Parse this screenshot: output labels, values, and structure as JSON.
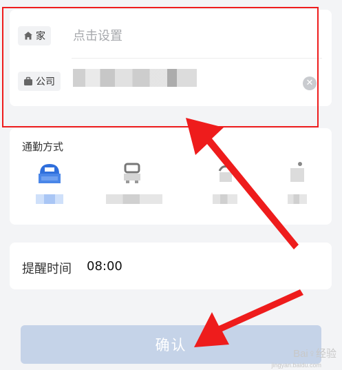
{
  "address": {
    "home_label": "家",
    "home_placeholder": "点击设置",
    "office_label": "公司",
    "clear_icon": "clear-icon"
  },
  "commute": {
    "title": "通勤方式",
    "modes": [
      {
        "name": "car",
        "selected": true
      },
      {
        "name": "bus",
        "selected": false
      },
      {
        "name": "bike",
        "selected": false
      },
      {
        "name": "walk",
        "selected": false
      }
    ]
  },
  "reminder": {
    "label": "提醒时间",
    "time": "08:00"
  },
  "confirm_label": "确认",
  "watermark": {
    "brand": "Bai♀经验",
    "url": "jingyan.baidu.com"
  },
  "colors": {
    "accent": "#4a86e8",
    "annotation": "#ee1c1c",
    "confirm_disabled": "#c5d3e8"
  }
}
